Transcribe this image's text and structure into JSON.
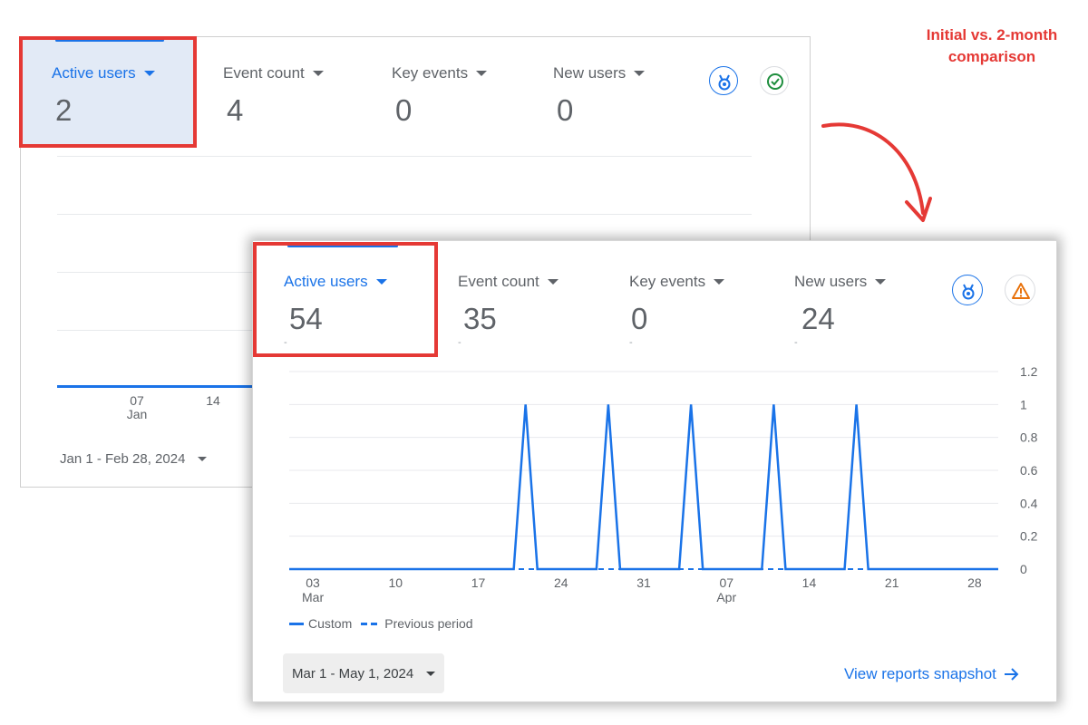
{
  "annotation": {
    "line1": "Initial vs. 2-month",
    "line2": "comparison"
  },
  "initial": {
    "metrics": [
      {
        "label": "Active users",
        "value": "2",
        "active": true
      },
      {
        "label": "Event count",
        "value": "4"
      },
      {
        "label": "Key events",
        "value": "0"
      },
      {
        "label": "New users",
        "value": "0"
      }
    ],
    "icons": [
      "insights-badge-icon",
      "check-circle-icon"
    ],
    "x_ticks": [
      {
        "day": "07",
        "month": "Jan"
      },
      {
        "day": "14",
        "month": ""
      }
    ],
    "date_range": "Jan 1 - Feb 28, 2024"
  },
  "twomonth": {
    "metrics": [
      {
        "label": "Active users",
        "value": "54",
        "active": true
      },
      {
        "label": "Event count",
        "value": "35"
      },
      {
        "label": "Key events",
        "value": "0"
      },
      {
        "label": "New users",
        "value": "24"
      }
    ],
    "icons": [
      "insights-badge-icon",
      "warning-icon"
    ],
    "legend": {
      "custom": "Custom",
      "previous": "Previous period"
    },
    "date_range": "Mar 1 - May 1, 2024",
    "view_link": "View reports snapshot",
    "colors": {
      "line": "#1a73e8",
      "highlight": "#e53935",
      "warning": "#e8710a",
      "check": "#1e8e3e"
    }
  },
  "chart_data": {
    "type": "line",
    "title": "",
    "xlabel": "",
    "ylabel": "",
    "ylim": [
      0,
      1.2
    ],
    "y_ticks": [
      "1.2",
      "1",
      "0.8",
      "0.6",
      "0.4",
      "0.2",
      "0"
    ],
    "x_ticks": [
      {
        "day": "03",
        "month": "Mar"
      },
      {
        "day": "10",
        "month": ""
      },
      {
        "day": "17",
        "month": ""
      },
      {
        "day": "24",
        "month": ""
      },
      {
        "day": "31",
        "month": ""
      },
      {
        "day": "07",
        "month": "Apr"
      },
      {
        "day": "14",
        "month": ""
      },
      {
        "day": "21",
        "month": ""
      },
      {
        "day": "28",
        "month": ""
      }
    ],
    "series": [
      {
        "name": "Custom",
        "style": "solid",
        "spikes": [
          "Mar 21",
          "Mar 28",
          "Apr 4",
          "Apr 11",
          "Apr 18"
        ],
        "spike_value": 1,
        "base_value": 0
      },
      {
        "name": "Previous period",
        "style": "dashed",
        "base_value": 0
      }
    ]
  }
}
